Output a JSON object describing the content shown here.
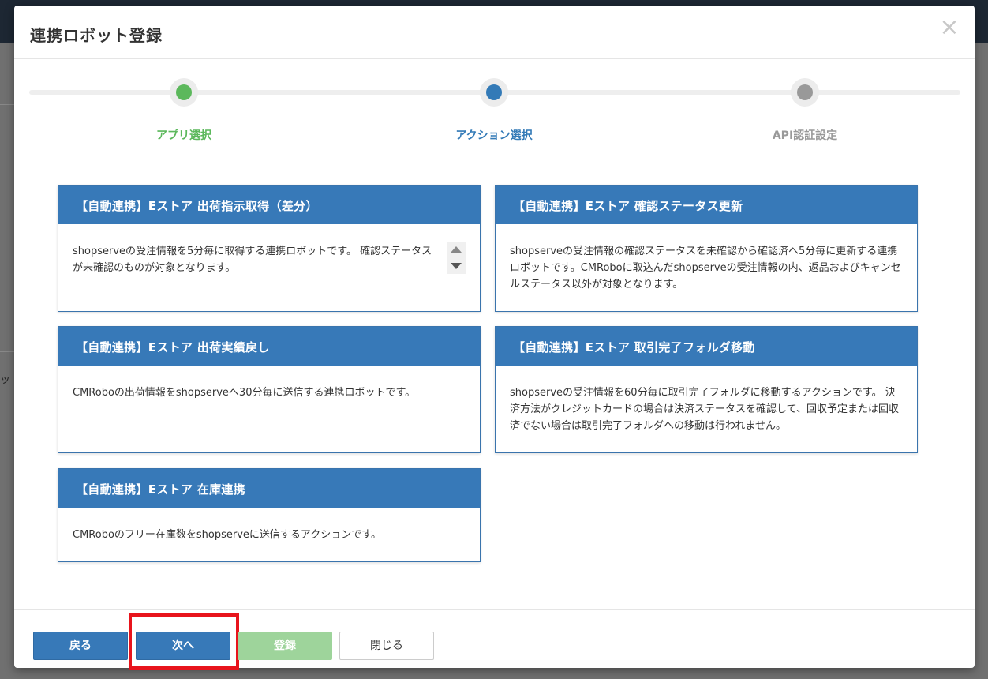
{
  "modal": {
    "title": "連携ロボット登録",
    "close_symbol": "×"
  },
  "steps": [
    {
      "label": "アプリ選択",
      "color": "#5cb85c",
      "state": "done"
    },
    {
      "label": "アクション選択",
      "color": "#337ab7",
      "state": "active"
    },
    {
      "label": "API認証設定",
      "color": "#999999",
      "state": "pending"
    }
  ],
  "cards": [
    {
      "title": "【自動連携】Eストア 出荷指示取得（差分）",
      "description": "shopserveの受注情報を5分毎に取得する連携ロボットです。 確認ステータスが未確認のものが対象となります。"
    },
    {
      "title": "【自動連携】Eストア 確認ステータス更新",
      "description": "shopserveの受注情報の確認ステータスを未確認から確認済へ5分毎に更新する連携ロボットです。CMRoboに取込んだshopserveの受注情報の内、返品およびキャンセルステータス以外が対象となります。"
    },
    {
      "title": "【自動連携】Eストア 出荷実績戻し",
      "description": "CMRoboの出荷情報をshopserveへ30分毎に送信する連携ロボットです。"
    },
    {
      "title": "【自動連携】Eストア 取引完了フォルダ移動",
      "description": "shopserveの受注情報を60分毎に取引完了フォルダに移動するアクションです。 決済方法がクレジットカードの場合は決済ステータスを確認して、回収予定または回収済でない場合は取引完了フォルダへの移動は行われません。"
    },
    {
      "title": "【自動連携】Eストア 在庫連携",
      "description": "CMRoboのフリー在庫数をshopserveに送信するアクションです。"
    }
  ],
  "footer": {
    "back_label": "戻る",
    "next_label": "次へ",
    "register_label": "登録",
    "close_label": "閉じる"
  },
  "background": {
    "edge_text": "ッ"
  },
  "colors": {
    "accent": "#3779b8",
    "success": "#5cb85c",
    "highlight": "#e8141c"
  }
}
